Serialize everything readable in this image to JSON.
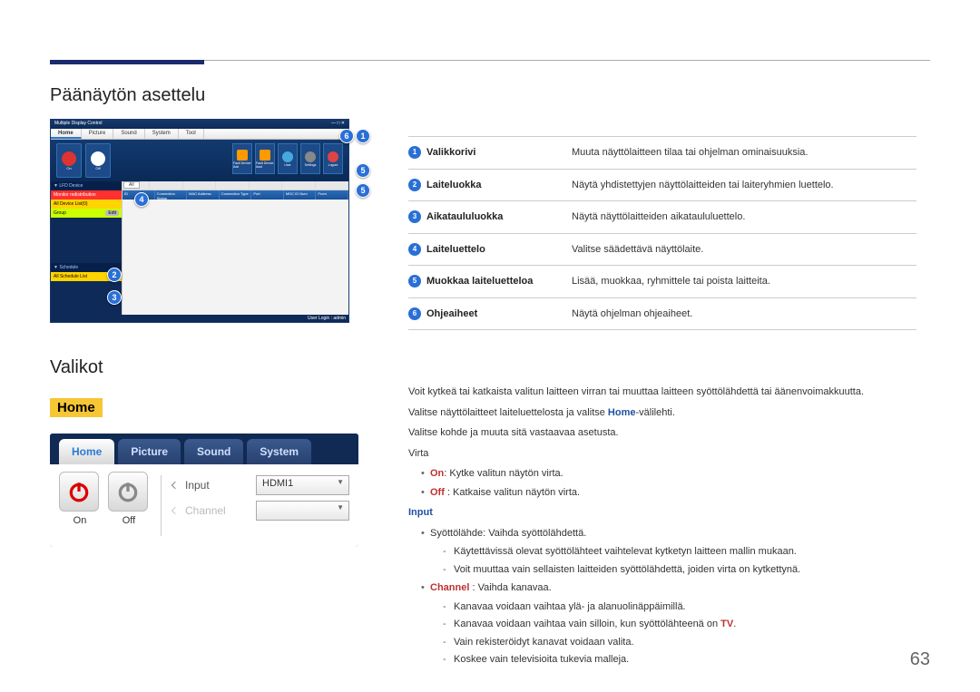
{
  "page_number": "63",
  "headings": {
    "layout": "Päänäytön asettelu",
    "menus": "Valikot",
    "home": "Home"
  },
  "mock1": {
    "title": "Multiple Display Control",
    "tabs": {
      "home": "Home",
      "picture": "Picture",
      "sound": "Sound",
      "system": "System",
      "tool": "Tool"
    },
    "toolbar": {
      "on": "On",
      "off": "Off",
      "fault_add": "Fault Device Add",
      "fault_asst": "Fault Device Asst",
      "user": "User",
      "settings": "Settings",
      "logout": "Logout"
    },
    "sidebar": {
      "lfd_section": "LFD Device",
      "monitor": "Monitor redistribution",
      "all_devices": "All Device List(0)",
      "group": "Group",
      "edit": "Edit",
      "schedule_section": "Schedule",
      "all_schedule": "All Schedule List"
    },
    "table": {
      "all": "All",
      "id": "ID",
      "conn": "Connection Status",
      "mac": "MAC Address",
      "type": "Connection Type",
      "port": "Port",
      "mdcid": "MDC ID Num",
      "from": "From"
    },
    "footer": "User Login : admin"
  },
  "mock2": {
    "tabs": {
      "home": "Home",
      "picture": "Picture",
      "sound": "Sound",
      "system": "System"
    },
    "on": "On",
    "off": "Off",
    "input_label": "Input",
    "input_value": "HDMI1",
    "channel_label": "Channel"
  },
  "legend": [
    {
      "n": "1",
      "label": "Valikkorivi",
      "desc": "Muuta näyttölaitteen tilaa tai ohjelman ominaisuuksia."
    },
    {
      "n": "2",
      "label": "Laiteluokka",
      "desc": "Näytä yhdistettyjen näyttölaitteiden tai laiteryhmien luettelo."
    },
    {
      "n": "3",
      "label": "Aikataululuokka",
      "desc": "Näytä näyttölaitteiden aikataululuettelo."
    },
    {
      "n": "4",
      "label": "Laiteluettelo",
      "desc": "Valitse säädettävä näyttölaite."
    },
    {
      "n": "5",
      "label": "Muokkaa laiteluetteloa",
      "desc": "Lisää, muokkaa, ryhmittele tai poista laitteita."
    },
    {
      "n": "6",
      "label": "Ohjeaiheet",
      "desc": "Näytä ohjelman ohjeaiheet."
    }
  ],
  "body": {
    "p1": "Voit kytkeä tai katkaista valitun laitteen virran tai muuttaa laitteen syöttölähdettä tai äänenvoimakkuutta.",
    "p2a": "Valitse näyttölaitteet laiteluettelosta ja valitse ",
    "p2b": "Home",
    "p2c": "-välilehti.",
    "p3": "Valitse kohde ja muuta sitä vastaavaa asetusta.",
    "virta": "Virta",
    "on_label": "On",
    "on_txt": ": Kytke valitun näytön virta.",
    "off_label": "Off",
    "off_txt": " : Katkaise valitun näytön virta.",
    "input_hdr": "Input",
    "input_txt": "Syöttölähde: Vaihda syöttölähdettä.",
    "input_sub1": "Käytettävissä olevat syöttölähteet vaihtelevat kytketyn laitteen mallin mukaan.",
    "input_sub2": "Voit muuttaa vain sellaisten laitteiden syöttölähdettä, joiden virta on kytkettynä.",
    "channel_label": "Channel",
    "channel_txt": " : Vaihda kanavaa.",
    "ch_sub1": "Kanavaa voidaan vaihtaa ylä- ja alanuolinäppäimillä.",
    "ch_sub2a": "Kanavaa voidaan vaihtaa vain silloin, kun syöttölähteenä on ",
    "ch_sub2b": "TV",
    "ch_sub2c": ".",
    "ch_sub3": "Vain rekisteröidyt kanavat voidaan valita.",
    "ch_sub4": "Koskee vain televisioita tukevia malleja."
  }
}
